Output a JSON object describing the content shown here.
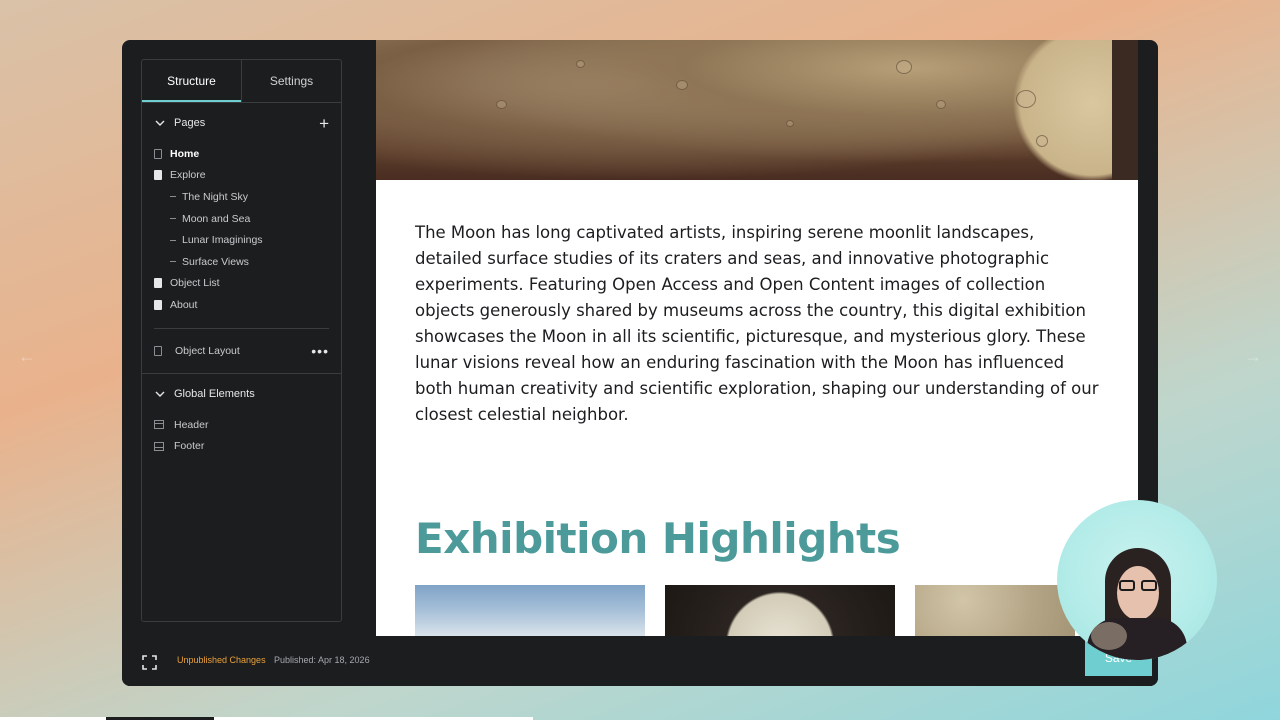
{
  "sidebar": {
    "tabs": [
      {
        "label": "Structure"
      },
      {
        "label": "Settings"
      }
    ],
    "pages_section": {
      "title": "Pages"
    },
    "pages": [
      {
        "label": "Home"
      },
      {
        "label": "Explore"
      }
    ],
    "explore_children": [
      {
        "label": "The Night Sky"
      },
      {
        "label": "Moon and Sea"
      },
      {
        "label": "Lunar Imaginings"
      },
      {
        "label": "Surface Views"
      }
    ],
    "more_pages": [
      {
        "label": "Object List"
      },
      {
        "label": "About"
      }
    ],
    "object_layout": {
      "label": "Object Layout",
      "menu": "•••"
    },
    "global_section": {
      "title": "Global Elements"
    },
    "global_items": [
      {
        "label": "Header"
      },
      {
        "label": "Footer"
      }
    ]
  },
  "preview": {
    "intro_text": "The Moon has long captivated artists, inspiring serene moonlit landscapes, detailed surface studies of its craters and seas, and innovative photographic experiments. Featuring Open Access and Open Content images of collection objects generously shared by museums across the country, this digital exhibition showcases the Moon in all its scientific, picturesque, and mysterious glory. These lunar visions reveal how an enduring fascination with the Moon has influenced both human creativity and scientific exploration, shaping our understanding of our closest celestial neighbor.",
    "highlights_title": "Exhibition Highlights",
    "accent_color": "#4c9a9a"
  },
  "footer": {
    "status": "Unpublished Changes",
    "published": "Published: Apr 18, 2026",
    "save_label": "Save",
    "status_color": "#e9a23b",
    "save_color": "#6fcfd0"
  },
  "nav": {
    "left_arrow": "←",
    "right_arrow": "→"
  }
}
